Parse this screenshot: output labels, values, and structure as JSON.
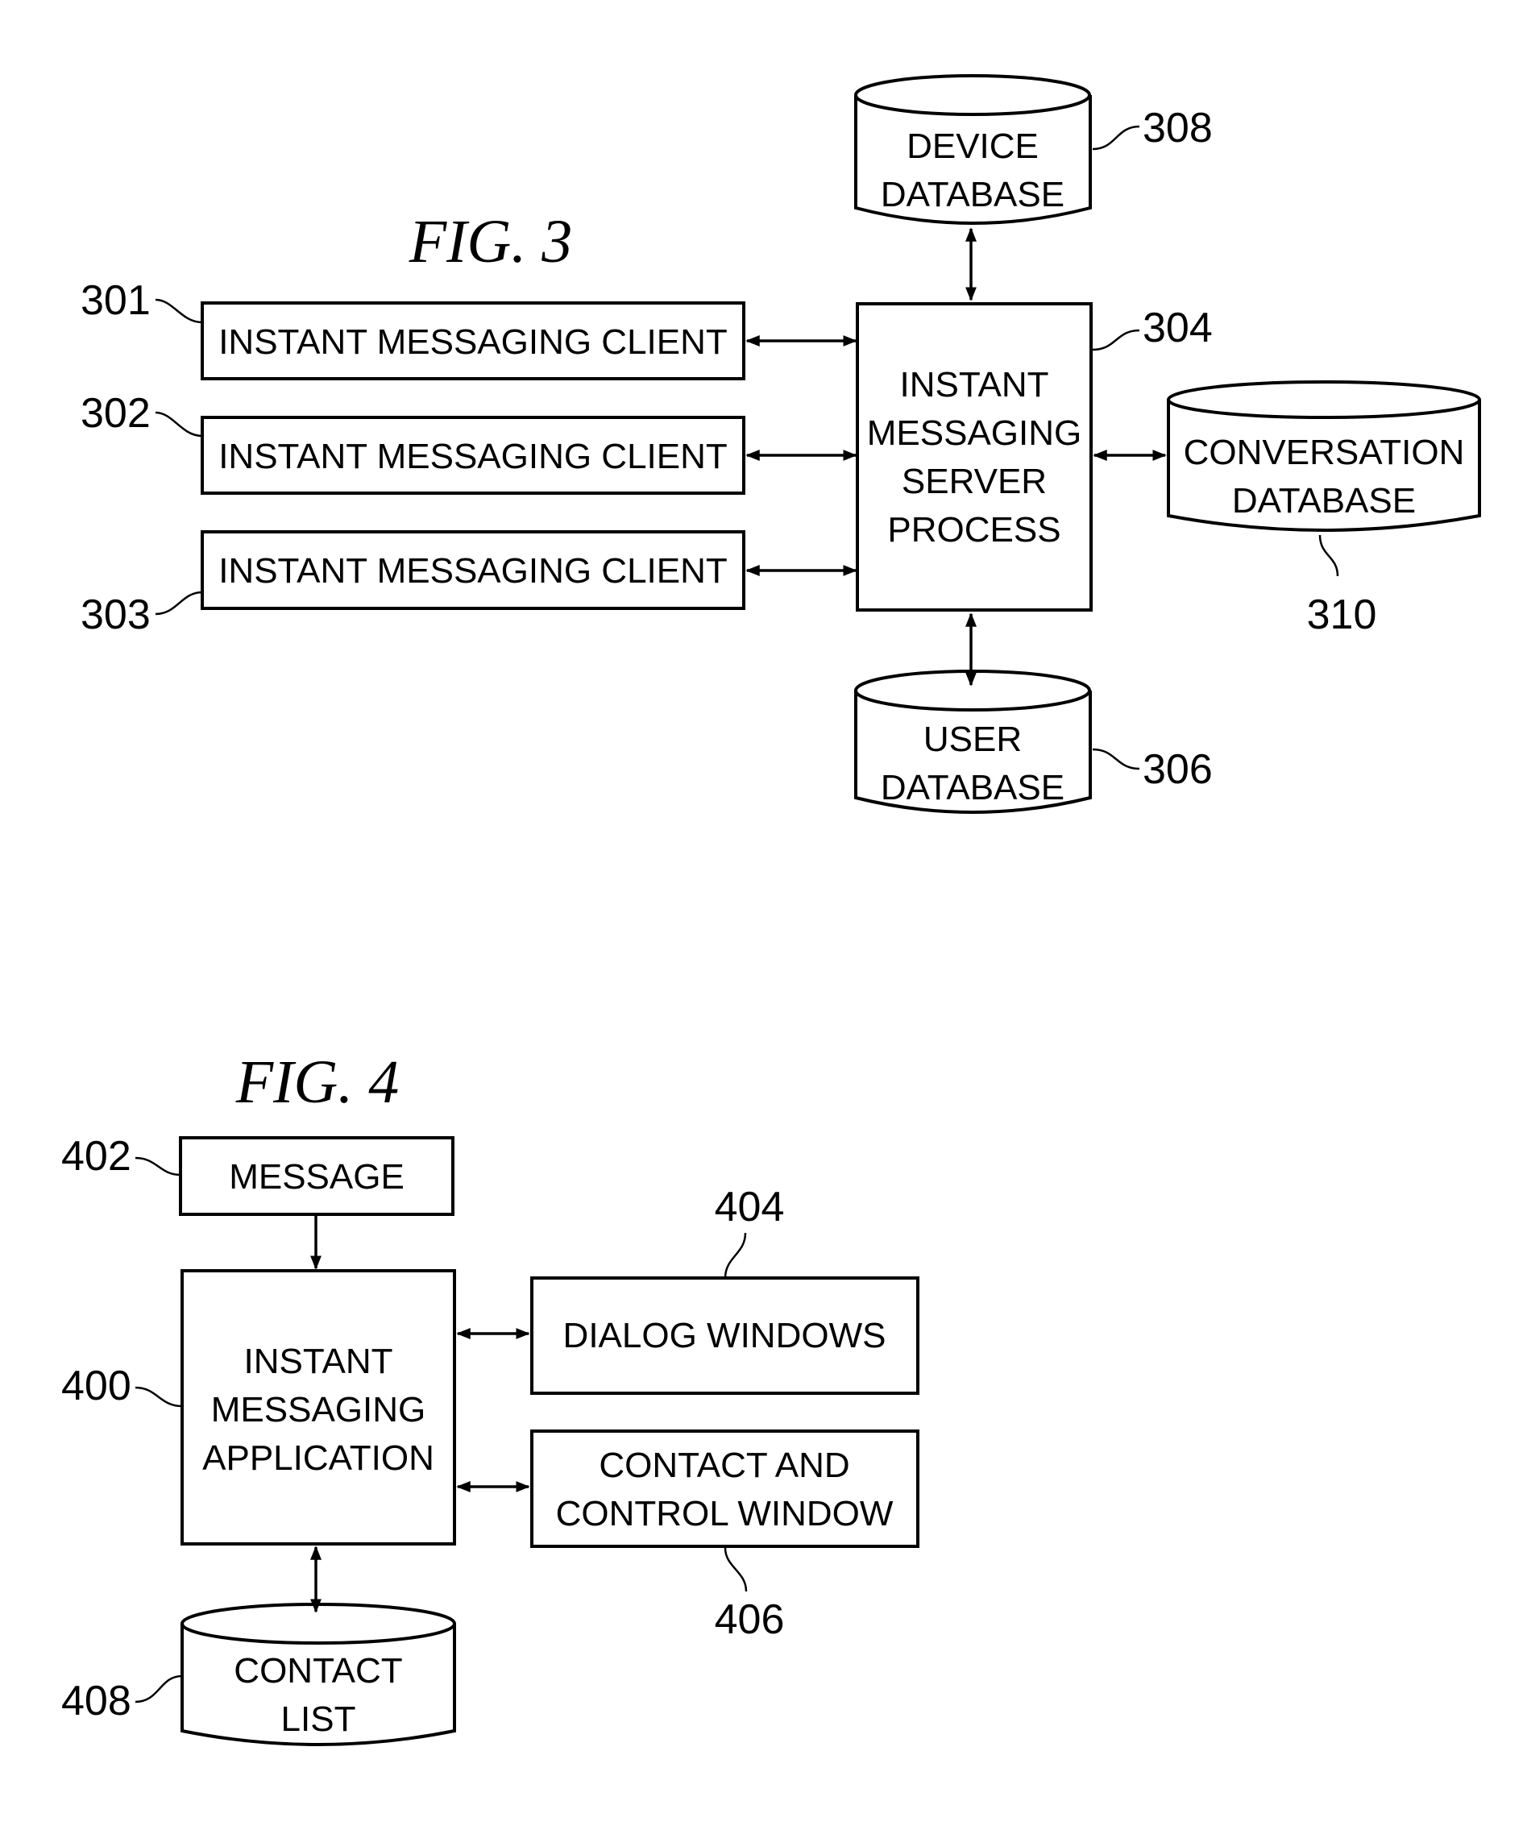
{
  "fig3": {
    "title": "FIG. 3",
    "clients": [
      {
        "ref": "301",
        "label": "INSTANT MESSAGING CLIENT"
      },
      {
        "ref": "302",
        "label": "INSTANT MESSAGING CLIENT"
      },
      {
        "ref": "303",
        "label": "INSTANT MESSAGING CLIENT"
      }
    ],
    "server": {
      "ref": "304",
      "lines": [
        "INSTANT",
        "MESSAGING",
        "SERVER",
        "PROCESS"
      ]
    },
    "device_db": {
      "ref": "308",
      "lines": [
        "DEVICE",
        "DATABASE"
      ]
    },
    "conversation_db": {
      "ref": "310",
      "lines": [
        "CONVERSATION",
        "DATABASE"
      ]
    },
    "user_db": {
      "ref": "306",
      "lines": [
        "USER",
        "DATABASE"
      ]
    }
  },
  "fig4": {
    "title": "FIG. 4",
    "message": {
      "ref": "402",
      "label": "MESSAGE"
    },
    "app": {
      "ref": "400",
      "lines": [
        "INSTANT",
        "MESSAGING",
        "APPLICATION"
      ]
    },
    "dialog": {
      "ref": "404",
      "label": "DIALOG WINDOWS"
    },
    "contact_control": {
      "ref": "406",
      "lines": [
        "CONTACT AND",
        "CONTROL WINDOW"
      ]
    },
    "contact_list": {
      "ref": "408",
      "lines": [
        "CONTACT",
        "LIST"
      ]
    }
  }
}
